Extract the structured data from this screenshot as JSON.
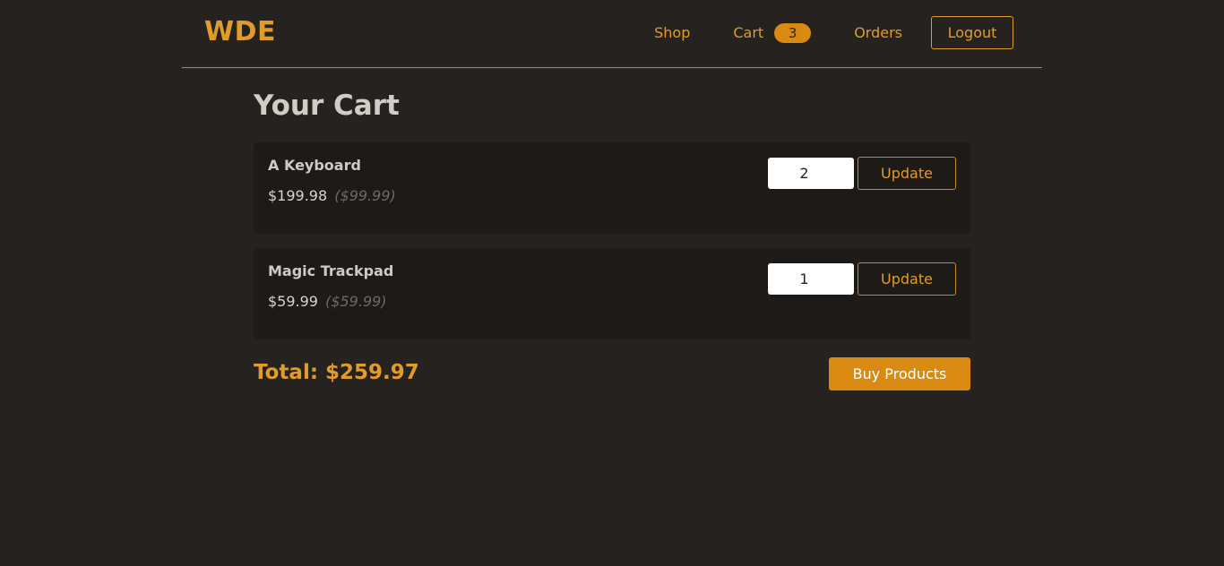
{
  "header": {
    "logo": "WDE",
    "nav": {
      "shop": "Shop",
      "cart": "Cart",
      "cart_count": "3",
      "orders": "Orders",
      "logout": "Logout"
    }
  },
  "main": {
    "title": "Your Cart",
    "items": [
      {
        "name": "A Keyboard",
        "total": "$199.98",
        "unit_price": "($99.99)",
        "quantity": "2",
        "update_label": "Update"
      },
      {
        "name": "Magic Trackpad",
        "total": "$59.99",
        "unit_price": "($59.99)",
        "quantity": "1",
        "update_label": "Update"
      }
    ],
    "total_label": "Total: $259.97",
    "buy_label": "Buy Products"
  },
  "colors": {
    "background": "#262220",
    "accent": "#e09c2a",
    "button_fill": "#d98a12",
    "card_background": "#1e1a18"
  }
}
